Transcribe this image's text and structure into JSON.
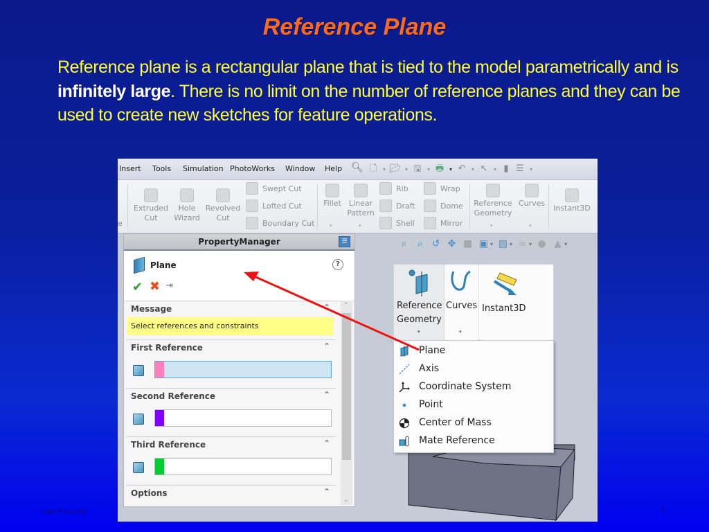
{
  "slide": {
    "title": "Reference Plane",
    "body_part1": "Reference plane is a rectangular plane that is tied to the model parametrically and is ",
    "body_emphasis": "infinitely large",
    "body_part2": ". There is no limit on the number of reference planes and they can be used to create new sketches for feature operations.",
    "author": "Ken Youssefi",
    "page_number": "6"
  },
  "app": {
    "menu": [
      "Insert",
      "Tools",
      "Simulation",
      "PhotoWorks",
      "Window",
      "Help"
    ],
    "ribbon": {
      "extruded_cut": "Extruded Cut",
      "hole_wizard": "Hole Wizard",
      "revolved_cut": "Revolved Cut",
      "swept_cut": "Swept Cut",
      "lofted_cut": "Lofted Cut",
      "boundary_cut": "Boundary Cut",
      "fillet": "Fillet",
      "linear_pattern": "Linear Pattern",
      "rib": "Rib",
      "draft": "Draft",
      "shell": "Shell",
      "wrap": "Wrap",
      "dome": "Dome",
      "mirror": "Mirror",
      "reference_geometry": "Reference Geometry",
      "curves": "Curves",
      "instant3d": "Instant3D"
    },
    "property_manager": {
      "header": "PropertyManager",
      "feature_title": "Plane",
      "groups": {
        "message": {
          "title": "Message",
          "text": "Select references and constraints"
        },
        "first_reference": {
          "title": "First Reference",
          "swatch_color": "#ff7fbf",
          "active": true
        },
        "second_reference": {
          "title": "Second Reference",
          "swatch_color": "#7f00ff"
        },
        "third_reference": {
          "title": "Third Reference",
          "swatch_color": "#00cc33"
        },
        "options": {
          "title": "Options"
        }
      }
    },
    "context_ribbon": {
      "reference_geometry_line1": "Reference",
      "reference_geometry_line2": "Geometry",
      "curves": "Curves",
      "instant3d": "Instant3D"
    },
    "reference_geometry_menu": [
      {
        "label": "Plane",
        "icon": "plane-icon"
      },
      {
        "label": "Axis",
        "icon": "axis-icon"
      },
      {
        "label": "Coordinate System",
        "icon": "coordinate-system-icon"
      },
      {
        "label": "Point",
        "icon": "point-icon"
      },
      {
        "label": "Center of Mass",
        "icon": "center-of-mass-icon"
      },
      {
        "label": "Mate Reference",
        "icon": "mate-reference-icon"
      }
    ],
    "annotation_color": "#ee1111"
  }
}
